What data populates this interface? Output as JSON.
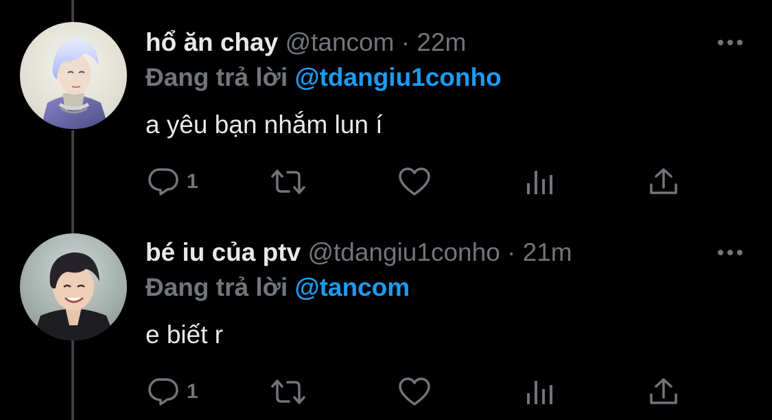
{
  "colors": {
    "background": "#000000",
    "primary_text": "#e7e9ea",
    "secondary_text": "#71767b",
    "accent": "#1d9bf0",
    "thread_line": "#3e4144"
  },
  "icons": {
    "more": "more-dots-icon",
    "reply": "reply-bubble-icon",
    "retweet": "retweet-icon",
    "like": "heart-icon",
    "views": "views-bar-chart-icon",
    "share": "share-upload-icon"
  },
  "tweets": [
    {
      "display_name": "hổ ăn chay",
      "meta": "@tancom · 22m",
      "reply_prefix": "Đang trả lời",
      "reply_target": "@tdangiu1conho",
      "text": "a yêu bạn nhắm lun í",
      "reply_count": "1"
    },
    {
      "display_name": "bé iu của ptv",
      "meta": "@tdangiu1conho · 21m",
      "reply_prefix": "Đang trả lời",
      "reply_target": "@tancom",
      "text": "e biết r",
      "reply_count": "1"
    }
  ]
}
